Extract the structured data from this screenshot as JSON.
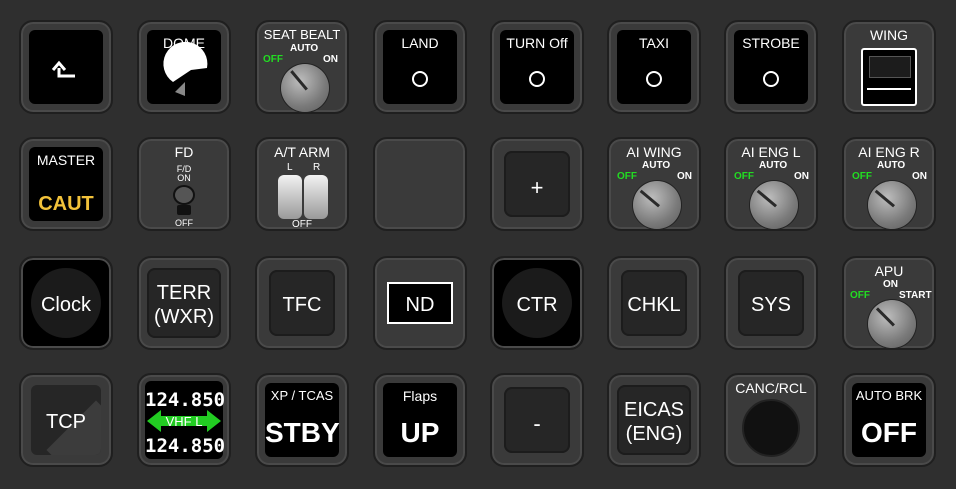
{
  "row1": {
    "back_icon": "return-arrow-icon",
    "dome": {
      "title": "DOME"
    },
    "seat_belt": {
      "title": "SEAT BEALT",
      "off": "OFF",
      "auto": "AUTO",
      "on": "ON"
    },
    "land": {
      "title": "LAND"
    },
    "turn_off": {
      "title": "TURN Off"
    },
    "taxi": {
      "title": "TAXI"
    },
    "strobe": {
      "title": "STROBE"
    },
    "wing": {
      "title": "WING"
    }
  },
  "row2": {
    "master": {
      "title": "MASTER",
      "value": "CAUT"
    },
    "fd": {
      "title": "FD",
      "fd_on": "F/D\nON",
      "off": "OFF"
    },
    "at_arm": {
      "title": "A/T ARM",
      "l": "L",
      "r": "R",
      "off": "OFF"
    },
    "plus": {
      "label": "+"
    },
    "ai_wing": {
      "title": "AI WING",
      "off": "OFF",
      "auto": "AUTO",
      "on": "ON"
    },
    "ai_eng_l": {
      "title": "AI ENG L",
      "off": "OFF",
      "auto": "AUTO",
      "on": "ON"
    },
    "ai_eng_r": {
      "title": "AI ENG R",
      "off": "OFF",
      "auto": "AUTO",
      "on": "ON"
    }
  },
  "row3": {
    "clock": {
      "label": "Clock"
    },
    "terr": {
      "line1": "TERR",
      "line2": "(WXR)"
    },
    "tfc": {
      "label": "TFC"
    },
    "nd": {
      "label": "ND"
    },
    "ctr": {
      "label": "CTR"
    },
    "chkl": {
      "label": "CHKL"
    },
    "sys": {
      "label": "SYS"
    },
    "apu": {
      "title": "APU",
      "off": "OFF",
      "on": "ON",
      "start": "START"
    }
  },
  "row4": {
    "tcp": {
      "label": "TCP"
    },
    "vhf": {
      "active": "124.850",
      "label": "VHF L",
      "standby": "124.850"
    },
    "xp_tcas": {
      "title": "XP / TCAS",
      "value": "STBY"
    },
    "flaps": {
      "title": "Flaps",
      "value": "UP"
    },
    "minus": {
      "label": "-"
    },
    "eicas": {
      "line1": "EICAS",
      "line2": "(ENG)"
    },
    "canc_rcl": {
      "title": "CANC/RCL"
    },
    "auto_brk": {
      "title": "AUTO BRK",
      "value": "OFF"
    }
  },
  "colors": {
    "green": "#22dd22",
    "amber": "#f2c23a",
    "panel": "#2f2f2f"
  }
}
